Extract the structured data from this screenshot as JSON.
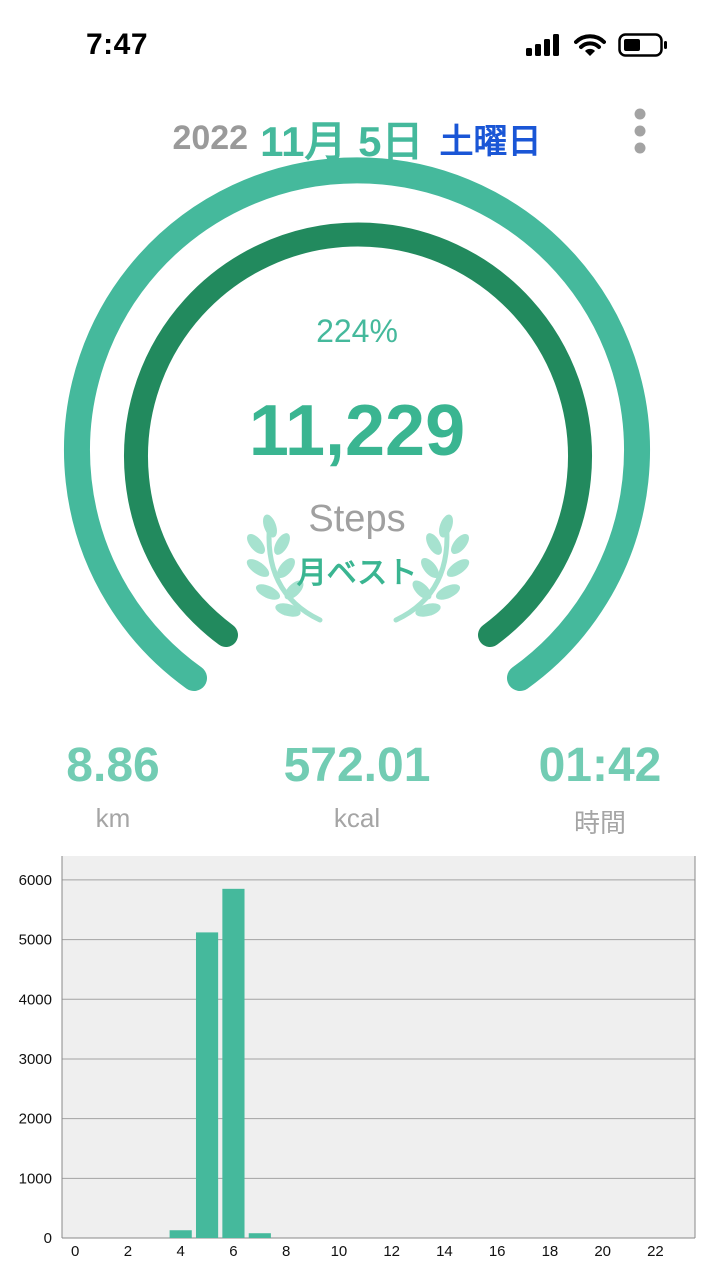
{
  "status_bar": {
    "time": "7:47"
  },
  "header": {
    "year": "2022",
    "month_day": "11月 5日",
    "weekday": "土曜日"
  },
  "gauge": {
    "percent": "224%",
    "steps": "11,229",
    "unit": "Steps",
    "badge": "月ベスト",
    "progress_fraction": 1.0
  },
  "stats": [
    {
      "value": "8.86",
      "label": "km"
    },
    {
      "value": "572.01",
      "label": "kcal"
    },
    {
      "value": "01:42",
      "label": "時間"
    }
  ],
  "colors": {
    "accent": "#45b99c",
    "accent_dark": "#228a5e",
    "weekday": "#1a56d6",
    "chart_bg": "#efefef"
  },
  "chart_data": {
    "type": "bar",
    "x": [
      4,
      5,
      6,
      7
    ],
    "values": [
      130,
      5120,
      5850,
      80
    ],
    "xlim": [
      -0.5,
      23.5
    ],
    "ylim": [
      0,
      6400
    ],
    "xticks": [
      0,
      2,
      4,
      6,
      8,
      10,
      12,
      14,
      16,
      18,
      20,
      22
    ],
    "yticks": [
      0,
      1000,
      2000,
      3000,
      4000,
      5000,
      6000
    ],
    "grid": true,
    "title": "",
    "xlabel": "",
    "ylabel": ""
  }
}
